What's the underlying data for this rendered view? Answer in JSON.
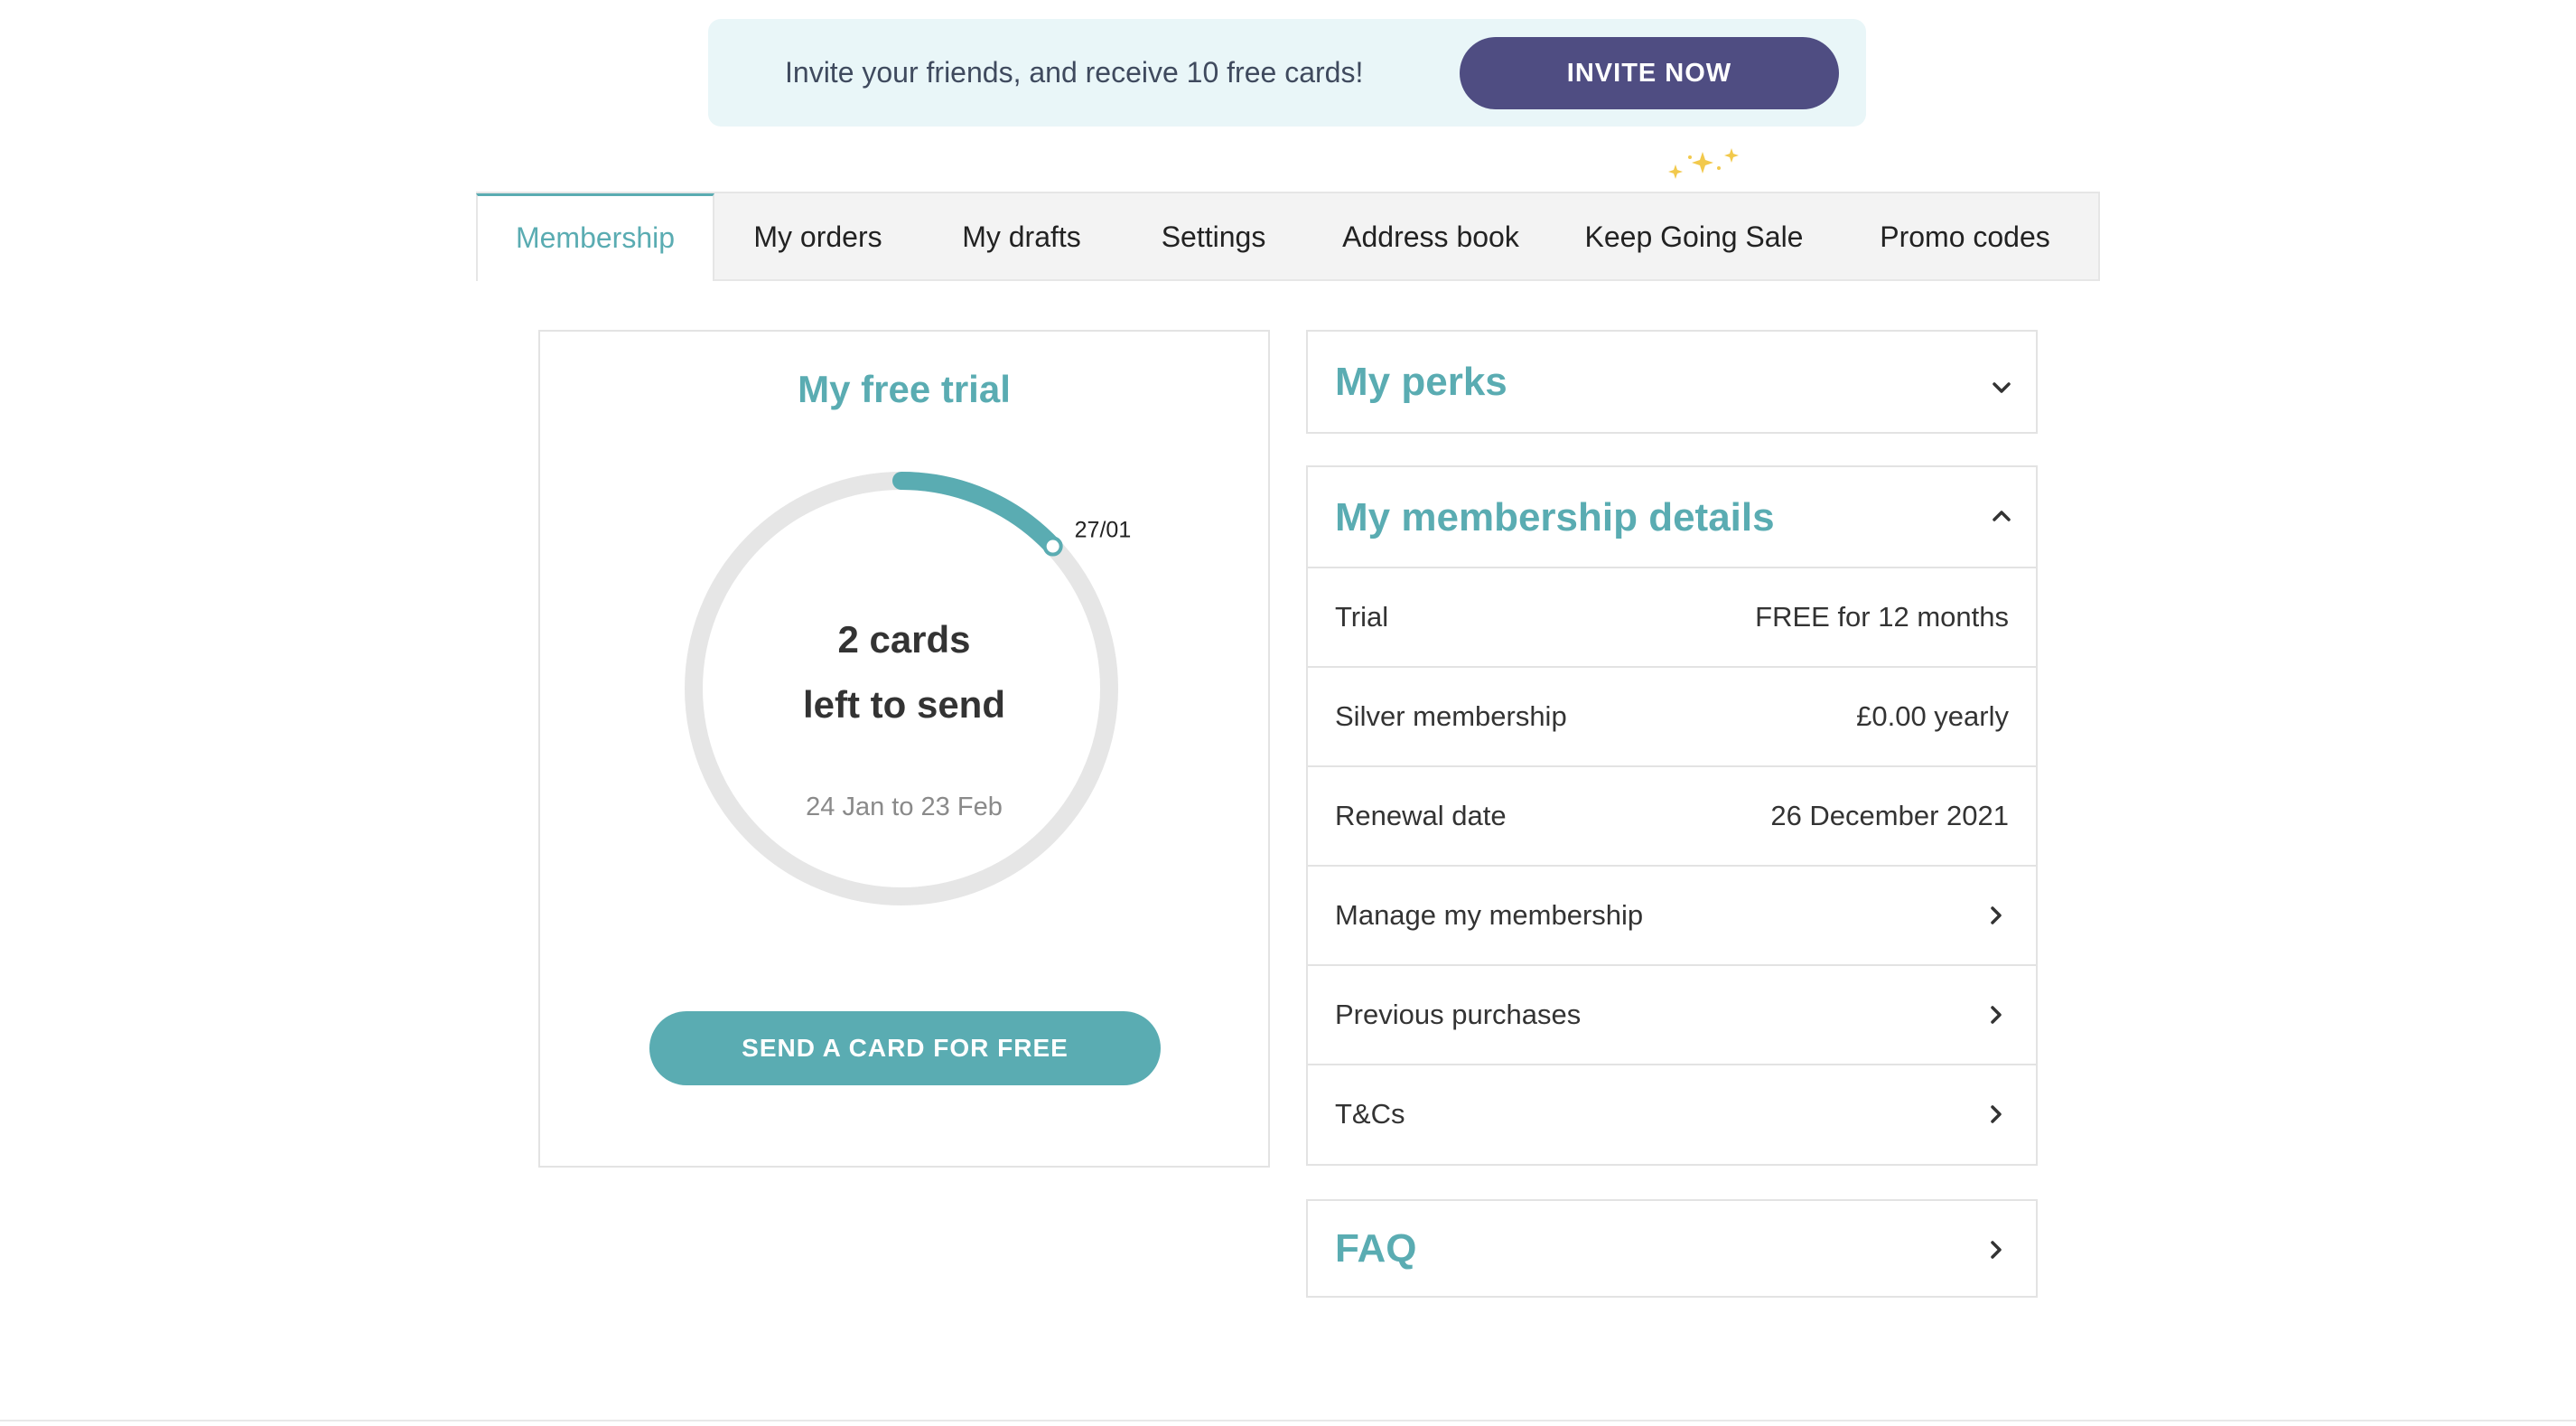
{
  "banner": {
    "text": "Invite your friends, and receive 10 free cards!",
    "button_label": "INVITE NOW"
  },
  "tabs": [
    {
      "label": "Membership",
      "active": true
    },
    {
      "label": "My orders",
      "active": false
    },
    {
      "label": "My drafts",
      "active": false
    },
    {
      "label": "Settings",
      "active": false
    },
    {
      "label": "Address book",
      "active": false
    },
    {
      "label": "Keep Going Sale",
      "active": false
    },
    {
      "label": "Promo codes",
      "active": false
    }
  ],
  "trial": {
    "title": "My free trial",
    "progress_marker_label": "27/01",
    "progress_fraction": 0.13,
    "cards_left_line1": "2 cards",
    "cards_left_line2": "left to send",
    "date_range": "24 Jan to 23 Feb",
    "send_button_label": "SEND A CARD FOR FREE"
  },
  "perks": {
    "title": "My perks"
  },
  "details": {
    "title": "My membership details",
    "rows": [
      {
        "label": "Trial",
        "value": "FREE for 12 months"
      },
      {
        "label": "Silver membership",
        "value": "£0.00 yearly"
      },
      {
        "label": "Renewal date",
        "value": "26 December 2021"
      },
      {
        "label": "Manage my membership"
      },
      {
        "label": "Previous purchases"
      },
      {
        "label": "T&Cs"
      }
    ]
  },
  "faq": {
    "title": "FAQ"
  },
  "colors": {
    "accent": "#5aacb2",
    "invite_button": "#4f4d82",
    "banner_bg": "#e9f6f8",
    "ring_track": "#e6e6e6",
    "sparkle": "#f2c94c"
  }
}
